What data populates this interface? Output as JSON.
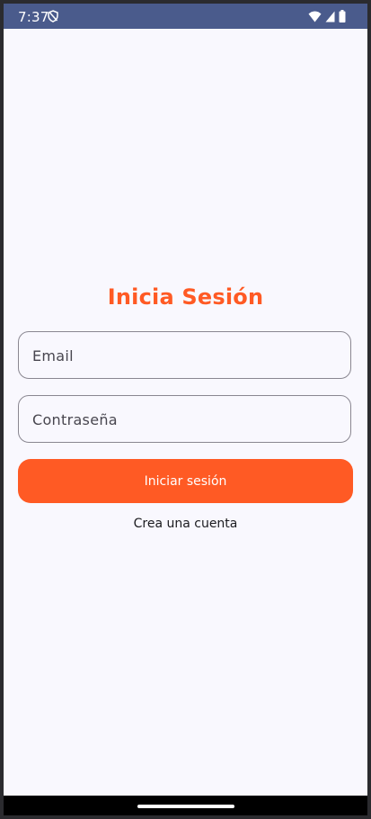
{
  "status_bar": {
    "time": "7:37",
    "left_icon": "privacy-shield-icon",
    "right_icons": [
      "wifi-icon",
      "signal-icon",
      "battery-icon"
    ],
    "background": "#4a5b8c"
  },
  "screen": {
    "title": "Inicia Sesión",
    "email_field": {
      "value": "",
      "placeholder": "Email"
    },
    "password_field": {
      "value": "",
      "placeholder": "Contraseña"
    },
    "login_button_label": "Iniciar sesión",
    "create_account_label": "Crea una cuenta"
  },
  "colors": {
    "accent": "#ff5a24",
    "background": "#f9f8fe",
    "field_border": "#8a8791"
  }
}
